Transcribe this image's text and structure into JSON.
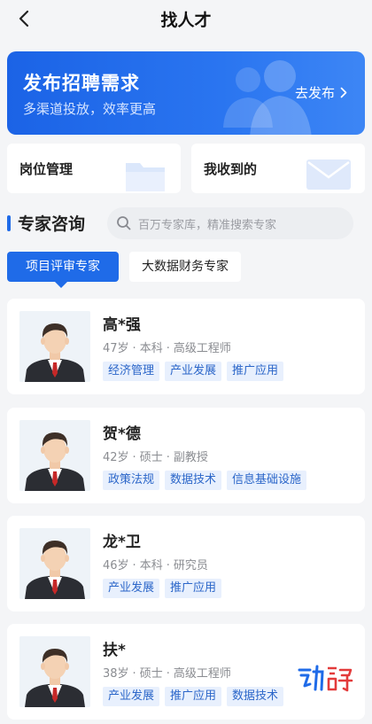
{
  "nav": {
    "title": "找人才"
  },
  "banner": {
    "title": "发布招聘需求",
    "subtitle": "多渠道投放，效率更高",
    "button": "去发布"
  },
  "quick_links": [
    {
      "label": "岗位管理"
    },
    {
      "label": "我收到的"
    }
  ],
  "section": {
    "title": "专家咨询"
  },
  "search": {
    "placeholder": "百万专家库，精准搜索专家"
  },
  "tabs": [
    {
      "label": "项目评审专家",
      "active": true
    },
    {
      "label": "大数据财务专家",
      "active": false
    }
  ],
  "experts": [
    {
      "name": "高*强",
      "age": "47岁",
      "degree": "本科",
      "title": "高级工程师",
      "tags": [
        "经济管理",
        "产业发展",
        "推广应用"
      ]
    },
    {
      "name": "贺*德",
      "age": "42岁",
      "degree": "硕士",
      "title": "副教授",
      "tags": [
        "政策法规",
        "数据技术",
        "信息基础设施"
      ]
    },
    {
      "name": "龙*卫",
      "age": "46岁",
      "degree": "本科",
      "title": "研究员",
      "tags": [
        "产业发展",
        "推广应用"
      ]
    },
    {
      "name": "扶*",
      "age": "38岁",
      "degree": "硕士",
      "title": "高级工程师",
      "tags": [
        "产业发展",
        "推广应用",
        "数据技术"
      ]
    }
  ],
  "watermark": {
    "text": "动静",
    "color": "#1f6be8",
    "accent": "#e33b3b"
  },
  "colors": {
    "primary": "#1f6be8",
    "tag_bg": "#e8f0fd",
    "tag_text": "#2b66c9"
  }
}
